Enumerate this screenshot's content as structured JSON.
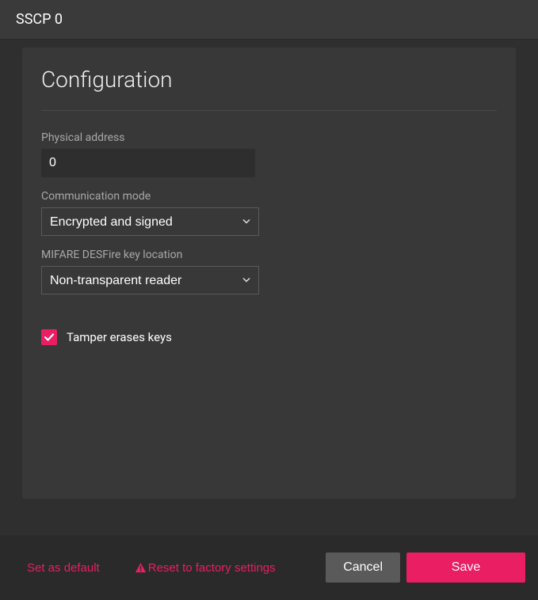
{
  "window": {
    "title": "SSCP 0"
  },
  "panel": {
    "heading": "Configuration"
  },
  "fields": {
    "physical_address": {
      "label": "Physical address",
      "value": "0"
    },
    "communication_mode": {
      "label": "Communication mode",
      "value": "Encrypted and signed"
    },
    "desfire_key_location": {
      "label": "MIFARE DESFire key location",
      "value": "Non-transparent reader"
    },
    "tamper_erases_keys": {
      "label": "Tamper erases keys",
      "checked": true
    }
  },
  "footer": {
    "set_default": "Set as default",
    "reset_factory": "Reset to factory settings",
    "cancel": "Cancel",
    "save": "Save"
  },
  "colors": {
    "accent": "#e91e63"
  }
}
